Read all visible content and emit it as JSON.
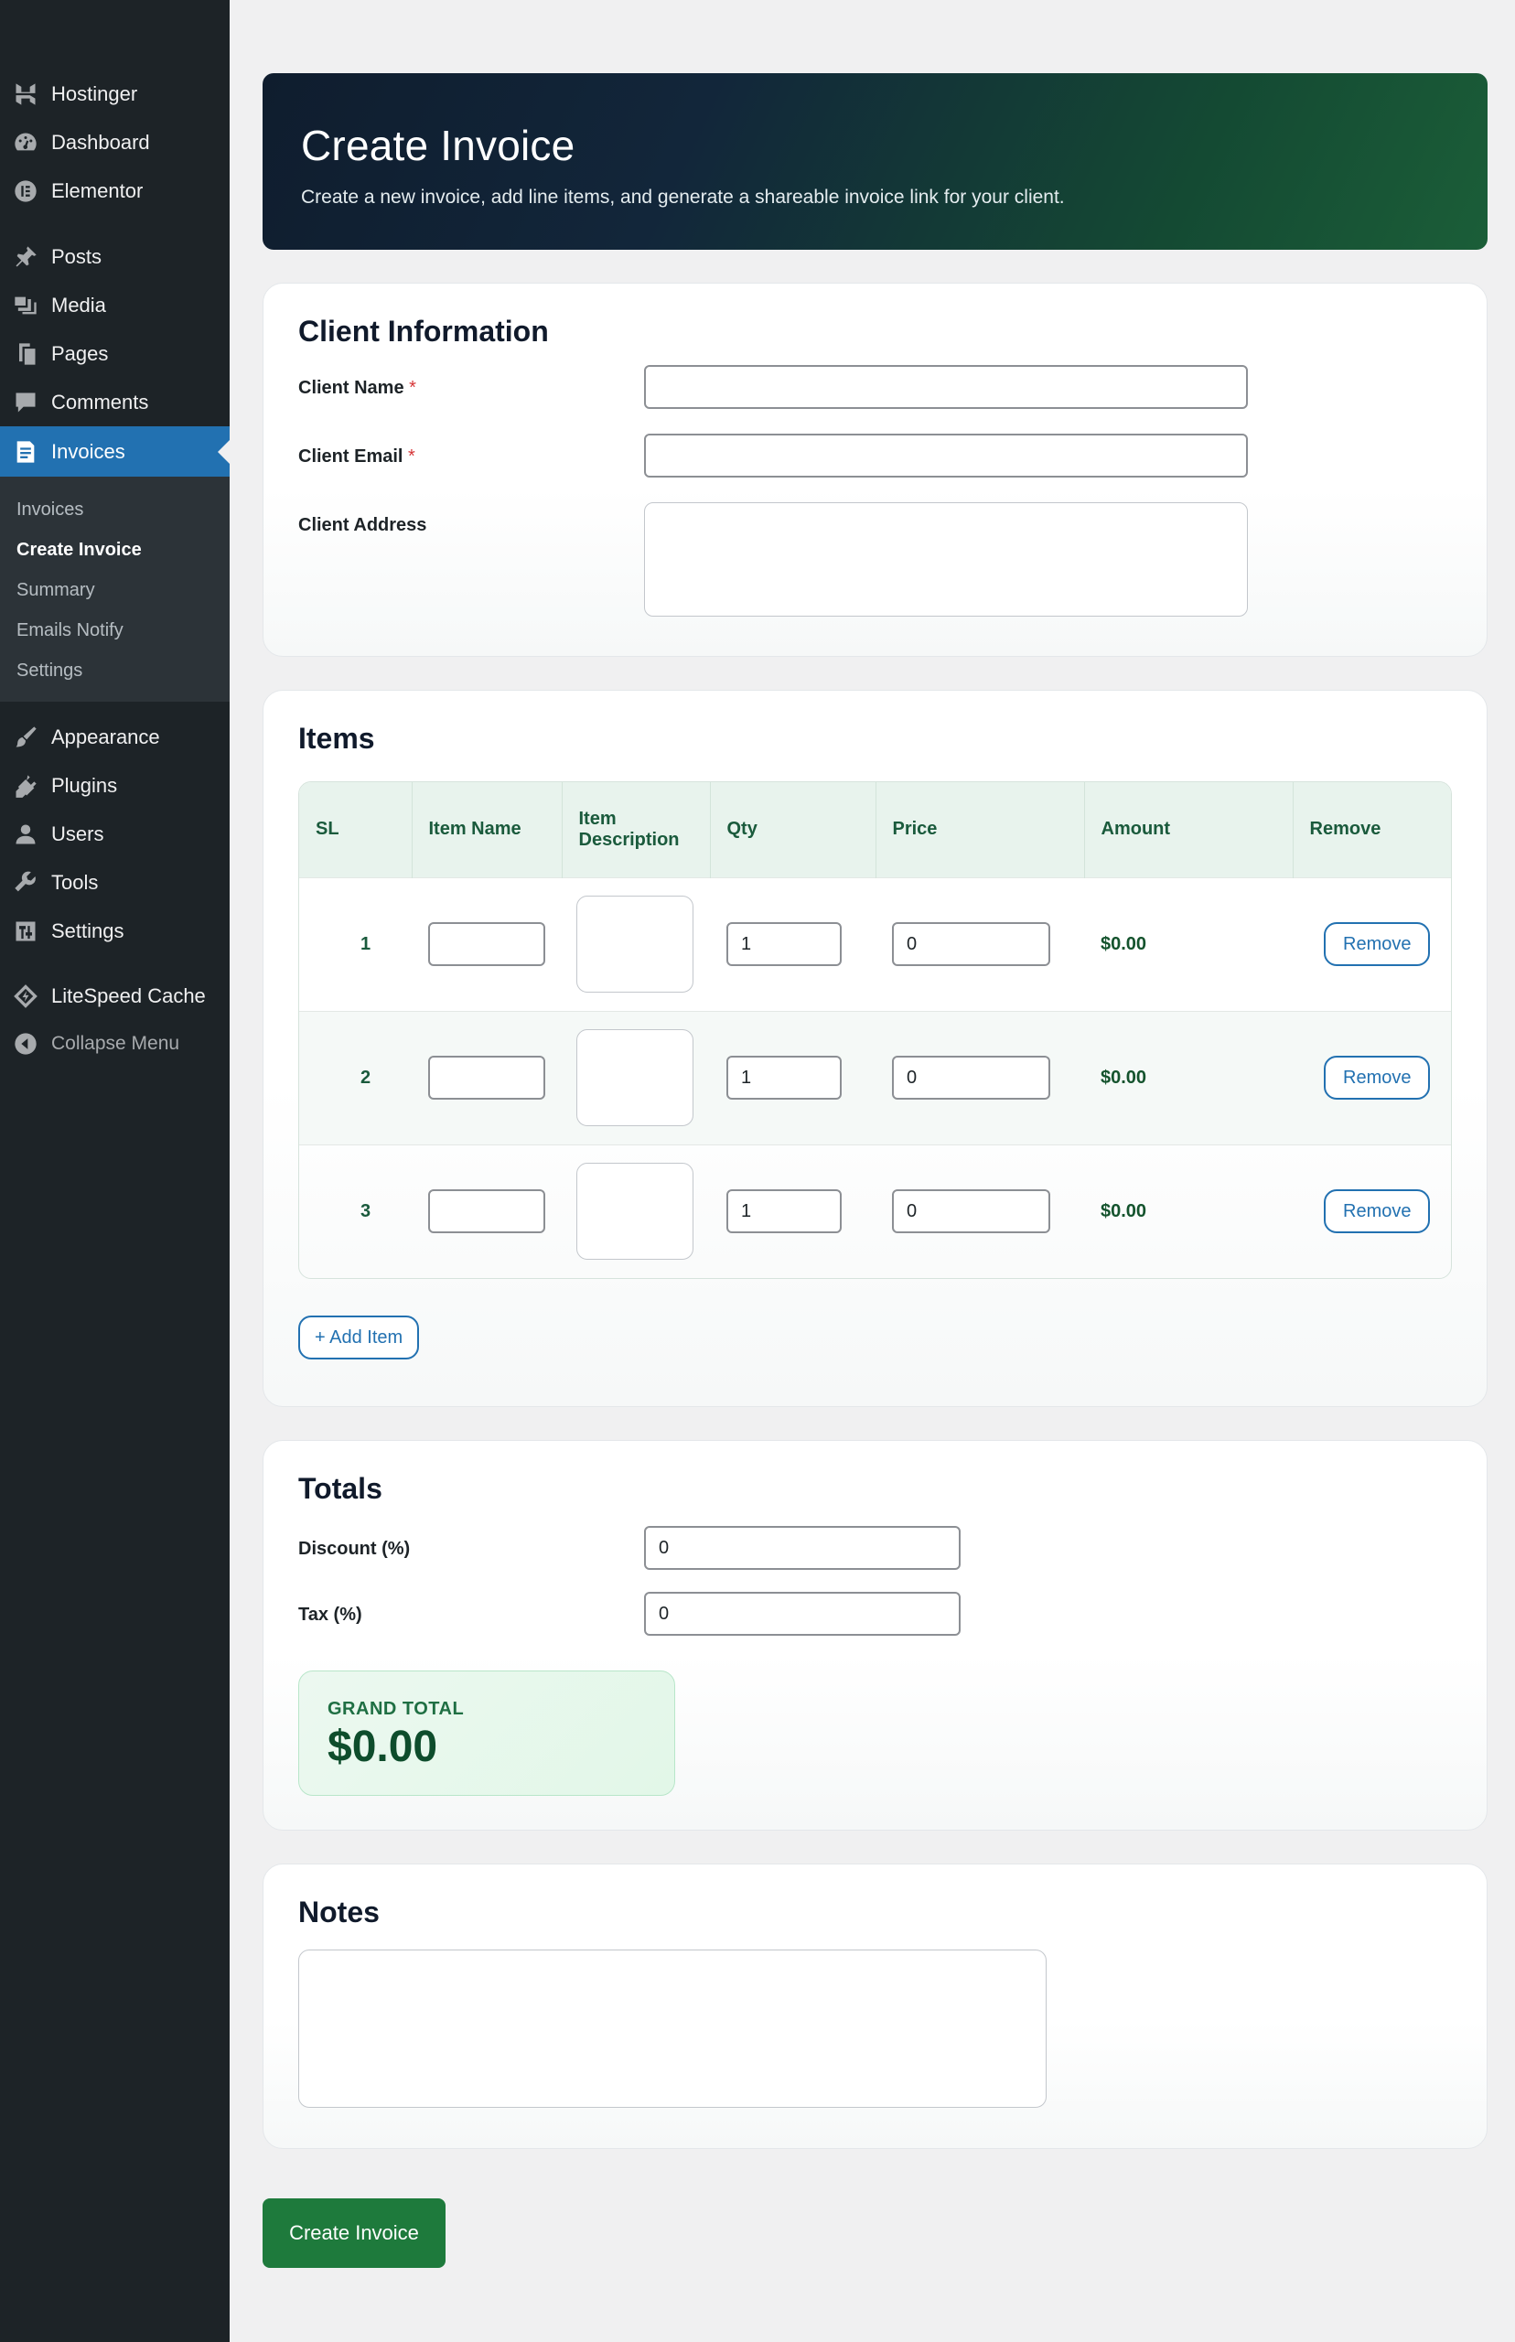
{
  "sidebar": {
    "items_top": [
      {
        "label": "Hostinger",
        "icon": "hostinger-icon"
      },
      {
        "label": "Dashboard",
        "icon": "dashboard-icon"
      },
      {
        "label": "Elementor",
        "icon": "elementor-icon"
      }
    ],
    "items_mid": [
      {
        "label": "Posts",
        "icon": "pin-icon"
      },
      {
        "label": "Media",
        "icon": "media-icon"
      },
      {
        "label": "Pages",
        "icon": "pages-icon"
      },
      {
        "label": "Comments",
        "icon": "comment-icon"
      }
    ],
    "active_item": {
      "label": "Invoices",
      "icon": "invoice-icon"
    },
    "submenu": [
      "Invoices",
      "Create Invoice",
      "Summary",
      "Emails Notify",
      "Settings"
    ],
    "submenu_current": "Create Invoice",
    "items_bottom": [
      {
        "label": "Appearance",
        "icon": "brush-icon"
      },
      {
        "label": "Plugins",
        "icon": "plugin-icon"
      },
      {
        "label": "Users",
        "icon": "user-icon"
      },
      {
        "label": "Tools",
        "icon": "wrench-icon"
      },
      {
        "label": "Settings",
        "icon": "settings-icon"
      }
    ],
    "litespeed": {
      "label": "LiteSpeed Cache",
      "icon": "litespeed-icon"
    },
    "collapse": {
      "label": "Collapse Menu",
      "icon": "collapse-icon"
    }
  },
  "hero": {
    "title": "Create Invoice",
    "subtitle": "Create a new invoice, add line items, and generate a shareable invoice link for your client."
  },
  "client": {
    "heading": "Client Information",
    "name_label": "Client Name",
    "email_label": "Client Email",
    "address_label": "Client Address",
    "required_mark": "*"
  },
  "items": {
    "heading": "Items",
    "columns": [
      "SL",
      "Item Name",
      "Item Description",
      "Qty",
      "Price",
      "Amount",
      "Remove"
    ],
    "rows": [
      {
        "sl": "1",
        "qty": "1",
        "price": "0",
        "amount": "$0.00",
        "remove": "Remove"
      },
      {
        "sl": "2",
        "qty": "1",
        "price": "0",
        "amount": "$0.00",
        "remove": "Remove"
      },
      {
        "sl": "3",
        "qty": "1",
        "price": "0",
        "amount": "$0.00",
        "remove": "Remove"
      }
    ],
    "add_label": "+ Add Item"
  },
  "totals": {
    "heading": "Totals",
    "discount_label": "Discount (%)",
    "discount_value": "0",
    "tax_label": "Tax (%)",
    "tax_value": "0",
    "grand_label": "GRAND TOTAL",
    "grand_value": "$0.00"
  },
  "notes": {
    "heading": "Notes"
  },
  "submit_label": "Create Invoice",
  "colors": {
    "accent_blue": "#2271b1",
    "brand_green": "#1e7a3c",
    "sidebar_bg": "#1d2327"
  }
}
